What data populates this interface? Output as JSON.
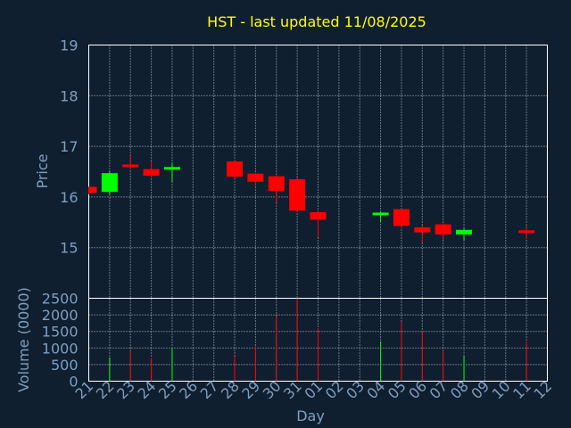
{
  "chart_data": {
    "type": "candlestick",
    "title": "HST - last updated 11/08/2025",
    "xlabel": "Day",
    "colors": {
      "background": "#0f1f30",
      "title": "#ffff00",
      "axis_text": "#7f9fbf",
      "grid": "#ffffff",
      "up": "#00ff00",
      "down": "#ff0000"
    },
    "price_panel": {
      "ylabel": "Price",
      "ylim": [
        14.0,
        19.0
      ],
      "yticks": [
        "15",
        "16",
        "17",
        "18",
        "19"
      ],
      "grid": true
    },
    "volume_panel": {
      "ylabel": "Volume (0000)",
      "ylim": [
        0,
        2500
      ],
      "yticks": [
        "0",
        "500",
        "1000",
        "1500",
        "2000",
        "2500"
      ],
      "grid": true
    },
    "xticks": [
      "21",
      "22",
      "23",
      "24",
      "25",
      "26",
      "27",
      "28",
      "29",
      "30",
      "31",
      "01",
      "02",
      "03",
      "04",
      "05",
      "06",
      "07",
      "08",
      "09",
      "10",
      "11",
      "12"
    ],
    "candles": [
      {
        "day": 0,
        "open": 16.2,
        "high": 16.2,
        "low": 16.05,
        "close": 16.08
      },
      {
        "day": 1,
        "open": 16.1,
        "high": 16.52,
        "low": 16.05,
        "close": 16.47,
        "volume": 720
      },
      {
        "day": 2,
        "open": 16.63,
        "high": 16.82,
        "low": 16.55,
        "close": 16.6,
        "volume": 900
      },
      {
        "day": 3,
        "open": 16.55,
        "high": 16.7,
        "low": 16.38,
        "close": 16.42,
        "volume": 700
      },
      {
        "day": 4,
        "open": 16.55,
        "high": 16.68,
        "low": 16.3,
        "close": 16.58,
        "volume": 1000
      },
      {
        "day": 7,
        "open": 16.7,
        "high": 16.72,
        "low": 16.35,
        "close": 16.4,
        "volume": 750
      },
      {
        "day": 8,
        "open": 16.46,
        "high": 16.48,
        "low": 16.22,
        "close": 16.3,
        "volume": 1050
      },
      {
        "day": 9,
        "open": 16.41,
        "high": 16.43,
        "low": 15.88,
        "close": 16.12,
        "volume": 1950
      },
      {
        "day": 10,
        "open": 16.35,
        "high": 16.4,
        "low": 15.7,
        "close": 15.73,
        "volume": 2500
      },
      {
        "day": 11,
        "open": 15.7,
        "high": 15.72,
        "low": 15.2,
        "close": 15.55,
        "volume": 1600
      },
      {
        "day": 14,
        "open": 15.65,
        "high": 15.7,
        "low": 15.5,
        "close": 15.68,
        "volume": 1200
      },
      {
        "day": 15,
        "open": 15.76,
        "high": 15.77,
        "low": 15.38,
        "close": 15.43,
        "volume": 1800
      },
      {
        "day": 16,
        "open": 15.4,
        "high": 15.45,
        "low": 15.1,
        "close": 15.3,
        "volume": 1500
      },
      {
        "day": 17,
        "open": 15.46,
        "high": 15.48,
        "low": 15.15,
        "close": 15.26,
        "volume": 900
      },
      {
        "day": 18,
        "open": 15.26,
        "high": 15.38,
        "low": 15.15,
        "close": 15.35,
        "volume": 750
      },
      {
        "day": 21,
        "open": 15.33,
        "high": 15.45,
        "low": 15.18,
        "close": 15.3,
        "volume": 1200
      }
    ]
  }
}
